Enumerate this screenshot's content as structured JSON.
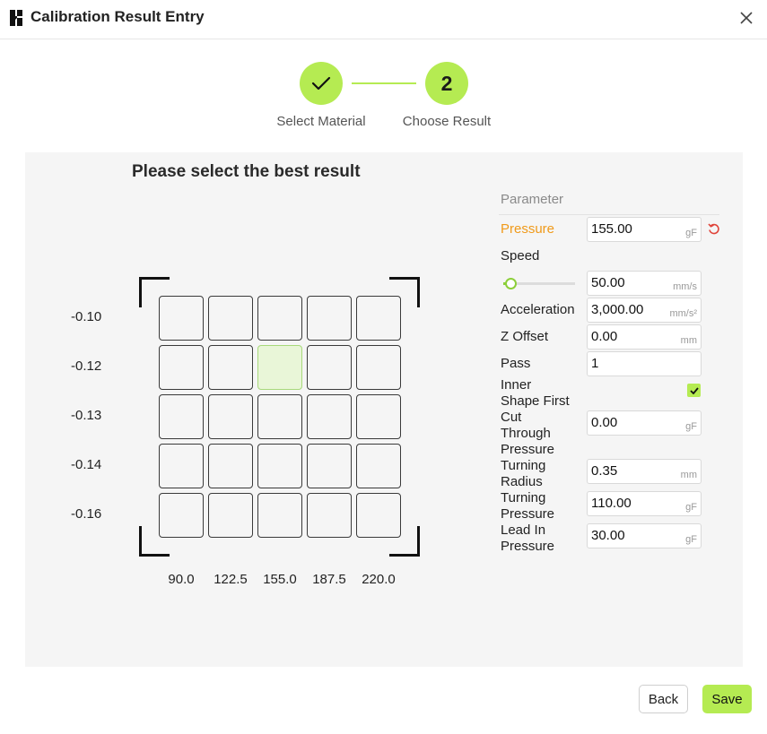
{
  "window": {
    "title": "Calibration Result Entry",
    "logo_icon": "bambu-logo-icon",
    "close_icon": "close-icon"
  },
  "stepper": {
    "steps": [
      {
        "label": "Select Material",
        "state": "done",
        "icon": "check-icon"
      },
      {
        "label": "Choose Result",
        "state": "active",
        "number": "2"
      }
    ],
    "accent_color": "#b5eb52"
  },
  "panel": {
    "heading": "Please select the best result",
    "row_labels": [
      "-0.10",
      "-0.12",
      "-0.13",
      "-0.14",
      "-0.16"
    ],
    "col_labels": [
      "90.0",
      "122.5",
      "155.0",
      "187.5",
      "220.0"
    ],
    "selected_cell": {
      "row": 1,
      "col": 2
    }
  },
  "parameters": {
    "header": "Parameter",
    "reset_icon": "reset-icon",
    "pressure": {
      "label": "Pressure",
      "value": "155.00",
      "unit": "gF"
    },
    "speed": {
      "label": "Speed",
      "value": "50.00",
      "unit": "mm/s",
      "slider_fraction": 0.1
    },
    "acceleration": {
      "label": "Acceleration",
      "value": "3,000.00",
      "unit": "mm/s²"
    },
    "z_offset": {
      "label": "Z Offset",
      "value": "0.00",
      "unit": "mm"
    },
    "pass": {
      "label": "Pass",
      "value": "1"
    },
    "inner_shape_first": {
      "label_lines": [
        "Inner",
        "Shape First"
      ],
      "checked": true
    },
    "cut_through_pressure": {
      "label_lines": [
        "Cut",
        "Through",
        "Pressure"
      ],
      "value": "0.00",
      "unit": "gF"
    },
    "turning_radius": {
      "label_lines": [
        "Turning",
        "Radius"
      ],
      "value": "0.35",
      "unit": "mm"
    },
    "turning_pressure": {
      "label_lines": [
        "Turning",
        "Pressure"
      ],
      "value": "110.00",
      "unit": "gF"
    },
    "lead_in_pressure": {
      "label_lines": [
        "Lead In",
        "Pressure"
      ],
      "value": "30.00",
      "unit": "gF"
    }
  },
  "footer": {
    "back_label": "Back",
    "save_label": "Save"
  }
}
